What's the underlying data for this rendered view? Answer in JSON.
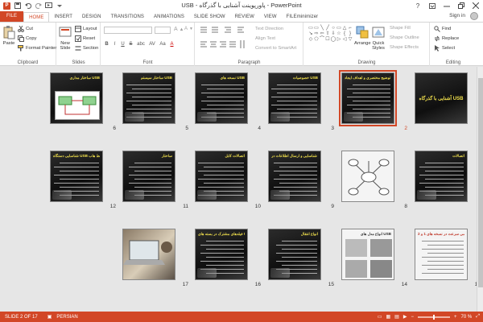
{
  "window": {
    "title": "USB - پاورپوینت آشنایی با گذرگاه - PowerPoint",
    "app_badge": "P"
  },
  "qat": {
    "save_icon": "save-icon",
    "undo_icon": "undo-icon",
    "redo_icon": "redo-icon",
    "start_icon": "slideshow-start-icon",
    "customize_icon": "customize-qat-icon"
  },
  "tabs": [
    "FILE",
    "HOME",
    "INSERT",
    "DESIGN",
    "TRANSITIONS",
    "ANIMATIONS",
    "SLIDE SHOW",
    "REVIEW",
    "VIEW",
    "FILEminimizer"
  ],
  "active_tab": "HOME",
  "account": {
    "sign_in": "Sign in"
  },
  "ribbon": {
    "clipboard": {
      "label": "Clipboard",
      "paste": "Paste",
      "cut": "Cut",
      "copy": "Copy",
      "format_painter": "Format Painter"
    },
    "slides": {
      "label": "Slides",
      "new_slide": "New",
      "new_slide2": "Slide",
      "layout": "Layout",
      "reset": "Reset",
      "section": "Section"
    },
    "font": {
      "label": "Font",
      "bold": "B",
      "italic": "I",
      "underline": "U",
      "strike": "S",
      "shadow": "abc",
      "spacing": "AV",
      "case": "Aa",
      "color": "A"
    },
    "paragraph": {
      "label": "Paragraph",
      "text_direction": "Text Direction",
      "align_text": "Align Text",
      "smartart": "Convert to SmartArt"
    },
    "drawing": {
      "label": "Drawing",
      "arrange": "Arrange",
      "quick": "Quick",
      "styles": "Styles",
      "shape_fill": "Shape Fill",
      "shape_outline": "Shape Outline",
      "shape_effects": "Shape Effects"
    },
    "editing": {
      "label": "Editing",
      "find": "Find",
      "replace": "Replace",
      "select": "Select"
    }
  },
  "slides": [
    {
      "num": "1",
      "title": "آشنایی با گذرگاه USB",
      "kind": "title"
    },
    {
      "num": "2",
      "title": "توضیح مختصری و اهداف ایجاد USB",
      "kind": "text",
      "selected": true
    },
    {
      "num": "3",
      "title": "خصوصیات USB",
      "kind": "text"
    },
    {
      "num": "4",
      "title": "نسخه های USB",
      "kind": "text"
    },
    {
      "num": "5",
      "title": "ساختار سیستم USB",
      "kind": "text"
    },
    {
      "num": "6",
      "title": "ساختار مداری USB",
      "kind": "diagram"
    },
    {
      "num": "7",
      "title": "اتصالات",
      "kind": "text"
    },
    {
      "num": "8",
      "title": "",
      "kind": "diagram-white"
    },
    {
      "num": "9",
      "title": "نحوه شناسایی و ارسال اطلاعات در USB",
      "kind": "text"
    },
    {
      "num": "10",
      "title": "اتصالات کابل",
      "kind": "text"
    },
    {
      "num": "11",
      "title": "ساختار",
      "kind": "text"
    },
    {
      "num": "12",
      "title": "شناسایی دستگاه USB توسط هاب",
      "kind": "text"
    },
    {
      "num": "13",
      "title": "بررسی سرعت در نسخه های 1 و 2",
      "kind": "white"
    },
    {
      "num": "14",
      "title": "انواع مدل های USB",
      "kind": "images"
    },
    {
      "num": "15",
      "title": "انواع انتقال",
      "kind": "text"
    },
    {
      "num": "16",
      "title": "فیلدهای مشترک در بسته های USB",
      "kind": "text"
    },
    {
      "num": "17",
      "title": "",
      "kind": "photo"
    }
  ],
  "status": {
    "slide_info": "SLIDE 2 OF 17",
    "language": "PERSIAN",
    "zoom": "70 %",
    "zoom_fraction": 0.5
  }
}
